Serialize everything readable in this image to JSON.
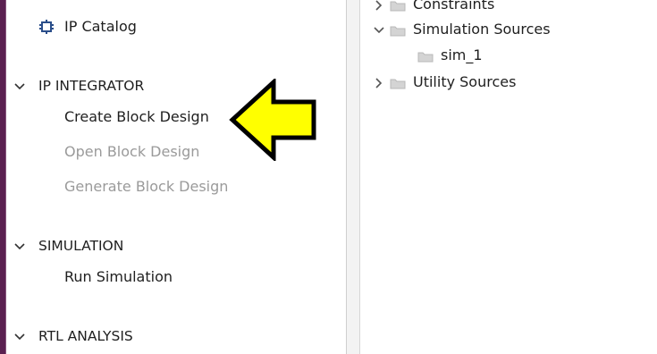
{
  "navigator": {
    "ip_catalog": {
      "label": "IP Catalog",
      "icon": "ip-catalog-icon"
    },
    "ip_integrator": {
      "header": "IP INTEGRATOR",
      "items": [
        "Create Block Design",
        "Open Block Design",
        "Generate Block Design"
      ]
    },
    "simulation": {
      "header": "SIMULATION",
      "items": [
        "Run Simulation"
      ]
    },
    "rtl_analysis": {
      "header": "RTL ANALYSIS"
    }
  },
  "sources_tree": {
    "constraints": "Constraints",
    "simulation_sources": "Simulation Sources",
    "sim_1": "sim_1",
    "utility_sources": "Utility Sources"
  },
  "colors": {
    "disabled_text": "#9a9a9a",
    "annotation_arrow_fill": "#ffff00",
    "left_edge": "#5a2050"
  }
}
